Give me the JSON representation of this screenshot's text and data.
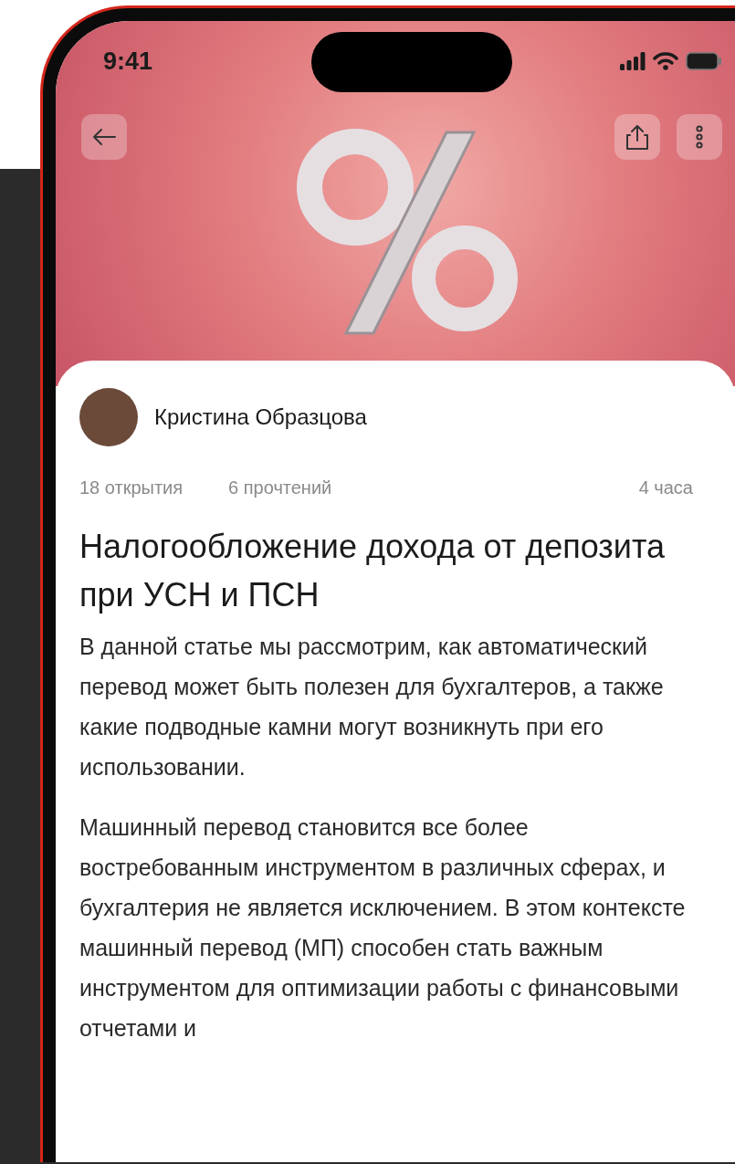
{
  "status_bar": {
    "time": "9:41"
  },
  "author": {
    "name": "Кристина Образцова"
  },
  "stats": {
    "opens": "18 открытия",
    "reads": "6 прочтений",
    "age": "4 часа"
  },
  "article": {
    "title": "Налогообложение дохода от депозита при УСН и ПСН",
    "paragraphs": [
      "В данной статье мы рассмотрим, как автоматический перевод может быть полезен для бухгалтеров, а также какие подводные камни могут возникнуть при его использовании.",
      "Машинный перевод становится все более востребованным инструментом в различных сферах, и бухгалтерия не является исключением. В этом контексте машинный перевод (МП) способен стать важным инструментом для оптимизации работы с финансовыми отчетами и"
    ]
  }
}
